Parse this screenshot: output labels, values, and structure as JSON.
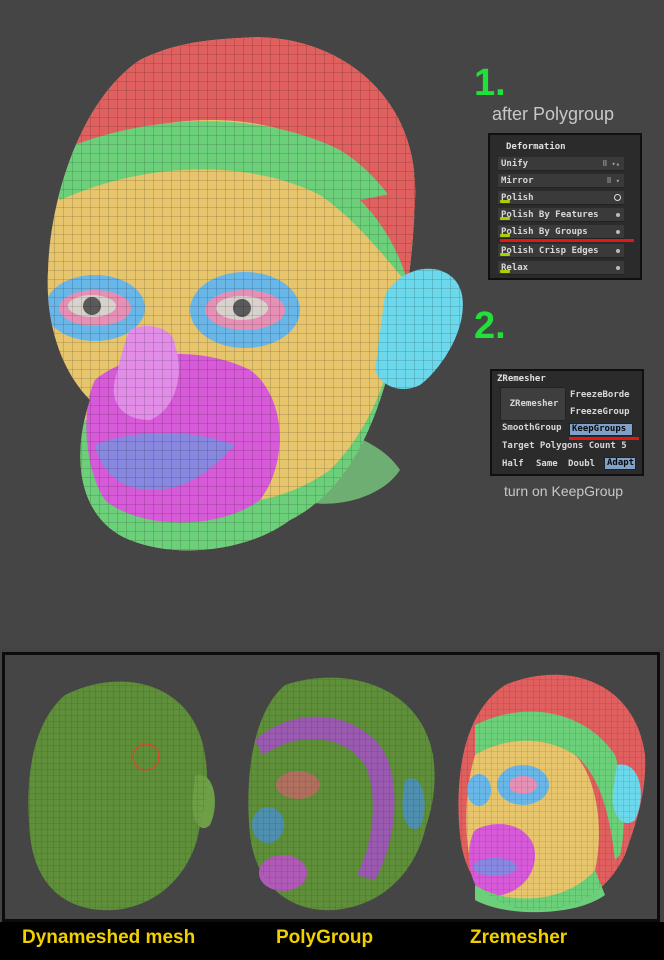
{
  "step1": {
    "number": "1.",
    "caption": "after Polygroup"
  },
  "step2": {
    "number": "2.",
    "caption": "turn on KeepGroup"
  },
  "deformation": {
    "title": "Deformation",
    "items": [
      "Unify",
      "Mirror",
      "Polish",
      "Polish By Features",
      "Polish By Groups",
      "Polish Crisp Edges",
      "Relax"
    ]
  },
  "zremesher": {
    "title": "ZRemesher",
    "button": "ZRemesher",
    "freeze_border": "FreezeBorde",
    "freeze_groups": "FreezeGroup",
    "smooth_groups": "SmoothGroup",
    "keep_groups": "KeepGroups",
    "target_polygons": "Target Polygons Count 5",
    "half": "Half",
    "same": "Same",
    "double": "Doubl",
    "adapt": "Adapt"
  },
  "bottom_labels": [
    "Dynameshed mesh",
    "PolyGroup",
    "Zremesher"
  ],
  "colors": {
    "accent_green": "#22e03a",
    "label_yellow": "#f2d000",
    "group_red": "#e06060",
    "group_green": "#6cd07a",
    "group_yellow": "#e6c56c",
    "group_blue": "#69b6e8",
    "group_magenta": "#d75ad8",
    "group_lips": "#8888e0",
    "group_ear": "#6cd8ec"
  }
}
